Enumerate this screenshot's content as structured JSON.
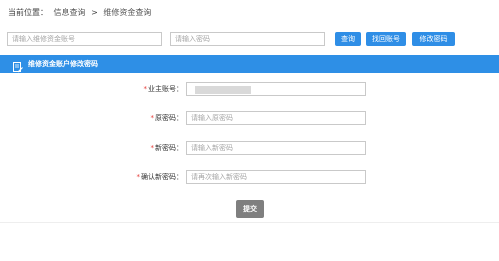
{
  "breadcrumb": {
    "prefix": "当前位置：",
    "items": [
      "信息查询",
      "维修资金查询"
    ],
    "separator": ">"
  },
  "search": {
    "account_placeholder": "请输入维修资金账号",
    "password_placeholder": "请输入密码",
    "query_label": "查询",
    "recover_label": "找回账号",
    "change_password_label": "修改密码"
  },
  "panel": {
    "title": "维修资金账户修改密码",
    "icon": "edit-document-icon"
  },
  "form": {
    "required_mark": "*",
    "account_label": "业主账号：",
    "old_password_label": "原密码：",
    "old_password_placeholder": "请输入原密码",
    "new_password_label": "新密码：",
    "new_password_placeholder": "请输入新密码",
    "confirm_password_label": "确认新密码：",
    "confirm_password_placeholder": "请再次输入新密码",
    "submit_label": "提交"
  },
  "colors": {
    "accent": "#2e8fe6",
    "submit": "#7f7f7f",
    "required": "#e53935"
  }
}
